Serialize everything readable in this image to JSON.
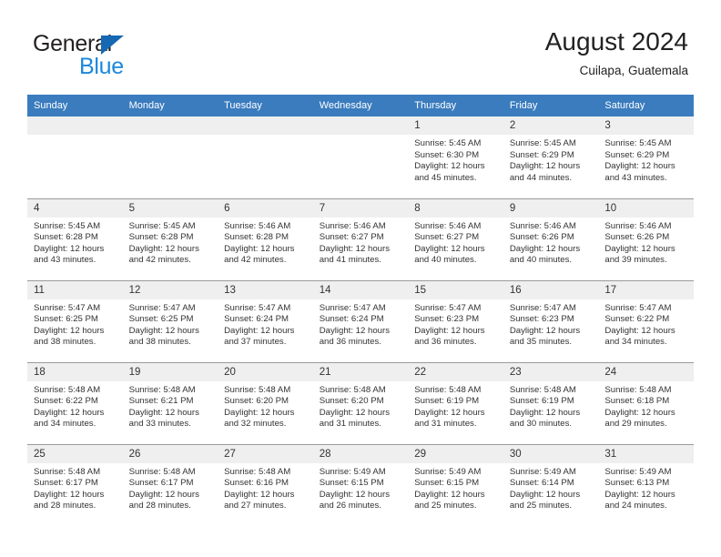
{
  "brand": {
    "name_dark": "General",
    "name_light": "Blue",
    "accent_color": "#1668b3",
    "light_color": "#1b87dc"
  },
  "header": {
    "title": "August 2024",
    "subtitle": "Cuilapa, Guatemala"
  },
  "calendar": {
    "header_bg": "#3a7cbe",
    "daynum_bg": "#efefef",
    "weekdays": [
      "Sunday",
      "Monday",
      "Tuesday",
      "Wednesday",
      "Thursday",
      "Friday",
      "Saturday"
    ],
    "weeks": [
      [
        {
          "day": "",
          "empty": true
        },
        {
          "day": "",
          "empty": true
        },
        {
          "day": "",
          "empty": true
        },
        {
          "day": "",
          "empty": true
        },
        {
          "day": "1",
          "sunrise": "Sunrise: 5:45 AM",
          "sunset": "Sunset: 6:30 PM",
          "daylight_1": "Daylight: 12 hours",
          "daylight_2": "and 45 minutes."
        },
        {
          "day": "2",
          "sunrise": "Sunrise: 5:45 AM",
          "sunset": "Sunset: 6:29 PM",
          "daylight_1": "Daylight: 12 hours",
          "daylight_2": "and 44 minutes."
        },
        {
          "day": "3",
          "sunrise": "Sunrise: 5:45 AM",
          "sunset": "Sunset: 6:29 PM",
          "daylight_1": "Daylight: 12 hours",
          "daylight_2": "and 43 minutes."
        }
      ],
      [
        {
          "day": "4",
          "sunrise": "Sunrise: 5:45 AM",
          "sunset": "Sunset: 6:28 PM",
          "daylight_1": "Daylight: 12 hours",
          "daylight_2": "and 43 minutes."
        },
        {
          "day": "5",
          "sunrise": "Sunrise: 5:45 AM",
          "sunset": "Sunset: 6:28 PM",
          "daylight_1": "Daylight: 12 hours",
          "daylight_2": "and 42 minutes."
        },
        {
          "day": "6",
          "sunrise": "Sunrise: 5:46 AM",
          "sunset": "Sunset: 6:28 PM",
          "daylight_1": "Daylight: 12 hours",
          "daylight_2": "and 42 minutes."
        },
        {
          "day": "7",
          "sunrise": "Sunrise: 5:46 AM",
          "sunset": "Sunset: 6:27 PM",
          "daylight_1": "Daylight: 12 hours",
          "daylight_2": "and 41 minutes."
        },
        {
          "day": "8",
          "sunrise": "Sunrise: 5:46 AM",
          "sunset": "Sunset: 6:27 PM",
          "daylight_1": "Daylight: 12 hours",
          "daylight_2": "and 40 minutes."
        },
        {
          "day": "9",
          "sunrise": "Sunrise: 5:46 AM",
          "sunset": "Sunset: 6:26 PM",
          "daylight_1": "Daylight: 12 hours",
          "daylight_2": "and 40 minutes."
        },
        {
          "day": "10",
          "sunrise": "Sunrise: 5:46 AM",
          "sunset": "Sunset: 6:26 PM",
          "daylight_1": "Daylight: 12 hours",
          "daylight_2": "and 39 minutes."
        }
      ],
      [
        {
          "day": "11",
          "sunrise": "Sunrise: 5:47 AM",
          "sunset": "Sunset: 6:25 PM",
          "daylight_1": "Daylight: 12 hours",
          "daylight_2": "and 38 minutes."
        },
        {
          "day": "12",
          "sunrise": "Sunrise: 5:47 AM",
          "sunset": "Sunset: 6:25 PM",
          "daylight_1": "Daylight: 12 hours",
          "daylight_2": "and 38 minutes."
        },
        {
          "day": "13",
          "sunrise": "Sunrise: 5:47 AM",
          "sunset": "Sunset: 6:24 PM",
          "daylight_1": "Daylight: 12 hours",
          "daylight_2": "and 37 minutes."
        },
        {
          "day": "14",
          "sunrise": "Sunrise: 5:47 AM",
          "sunset": "Sunset: 6:24 PM",
          "daylight_1": "Daylight: 12 hours",
          "daylight_2": "and 36 minutes."
        },
        {
          "day": "15",
          "sunrise": "Sunrise: 5:47 AM",
          "sunset": "Sunset: 6:23 PM",
          "daylight_1": "Daylight: 12 hours",
          "daylight_2": "and 36 minutes."
        },
        {
          "day": "16",
          "sunrise": "Sunrise: 5:47 AM",
          "sunset": "Sunset: 6:23 PM",
          "daylight_1": "Daylight: 12 hours",
          "daylight_2": "and 35 minutes."
        },
        {
          "day": "17",
          "sunrise": "Sunrise: 5:47 AM",
          "sunset": "Sunset: 6:22 PM",
          "daylight_1": "Daylight: 12 hours",
          "daylight_2": "and 34 minutes."
        }
      ],
      [
        {
          "day": "18",
          "sunrise": "Sunrise: 5:48 AM",
          "sunset": "Sunset: 6:22 PM",
          "daylight_1": "Daylight: 12 hours",
          "daylight_2": "and 34 minutes."
        },
        {
          "day": "19",
          "sunrise": "Sunrise: 5:48 AM",
          "sunset": "Sunset: 6:21 PM",
          "daylight_1": "Daylight: 12 hours",
          "daylight_2": "and 33 minutes."
        },
        {
          "day": "20",
          "sunrise": "Sunrise: 5:48 AM",
          "sunset": "Sunset: 6:20 PM",
          "daylight_1": "Daylight: 12 hours",
          "daylight_2": "and 32 minutes."
        },
        {
          "day": "21",
          "sunrise": "Sunrise: 5:48 AM",
          "sunset": "Sunset: 6:20 PM",
          "daylight_1": "Daylight: 12 hours",
          "daylight_2": "and 31 minutes."
        },
        {
          "day": "22",
          "sunrise": "Sunrise: 5:48 AM",
          "sunset": "Sunset: 6:19 PM",
          "daylight_1": "Daylight: 12 hours",
          "daylight_2": "and 31 minutes."
        },
        {
          "day": "23",
          "sunrise": "Sunrise: 5:48 AM",
          "sunset": "Sunset: 6:19 PM",
          "daylight_1": "Daylight: 12 hours",
          "daylight_2": "and 30 minutes."
        },
        {
          "day": "24",
          "sunrise": "Sunrise: 5:48 AM",
          "sunset": "Sunset: 6:18 PM",
          "daylight_1": "Daylight: 12 hours",
          "daylight_2": "and 29 minutes."
        }
      ],
      [
        {
          "day": "25",
          "sunrise": "Sunrise: 5:48 AM",
          "sunset": "Sunset: 6:17 PM",
          "daylight_1": "Daylight: 12 hours",
          "daylight_2": "and 28 minutes."
        },
        {
          "day": "26",
          "sunrise": "Sunrise: 5:48 AM",
          "sunset": "Sunset: 6:17 PM",
          "daylight_1": "Daylight: 12 hours",
          "daylight_2": "and 28 minutes."
        },
        {
          "day": "27",
          "sunrise": "Sunrise: 5:48 AM",
          "sunset": "Sunset: 6:16 PM",
          "daylight_1": "Daylight: 12 hours",
          "daylight_2": "and 27 minutes."
        },
        {
          "day": "28",
          "sunrise": "Sunrise: 5:49 AM",
          "sunset": "Sunset: 6:15 PM",
          "daylight_1": "Daylight: 12 hours",
          "daylight_2": "and 26 minutes."
        },
        {
          "day": "29",
          "sunrise": "Sunrise: 5:49 AM",
          "sunset": "Sunset: 6:15 PM",
          "daylight_1": "Daylight: 12 hours",
          "daylight_2": "and 25 minutes."
        },
        {
          "day": "30",
          "sunrise": "Sunrise: 5:49 AM",
          "sunset": "Sunset: 6:14 PM",
          "daylight_1": "Daylight: 12 hours",
          "daylight_2": "and 25 minutes."
        },
        {
          "day": "31",
          "sunrise": "Sunrise: 5:49 AM",
          "sunset": "Sunset: 6:13 PM",
          "daylight_1": "Daylight: 12 hours",
          "daylight_2": "and 24 minutes."
        }
      ]
    ]
  }
}
